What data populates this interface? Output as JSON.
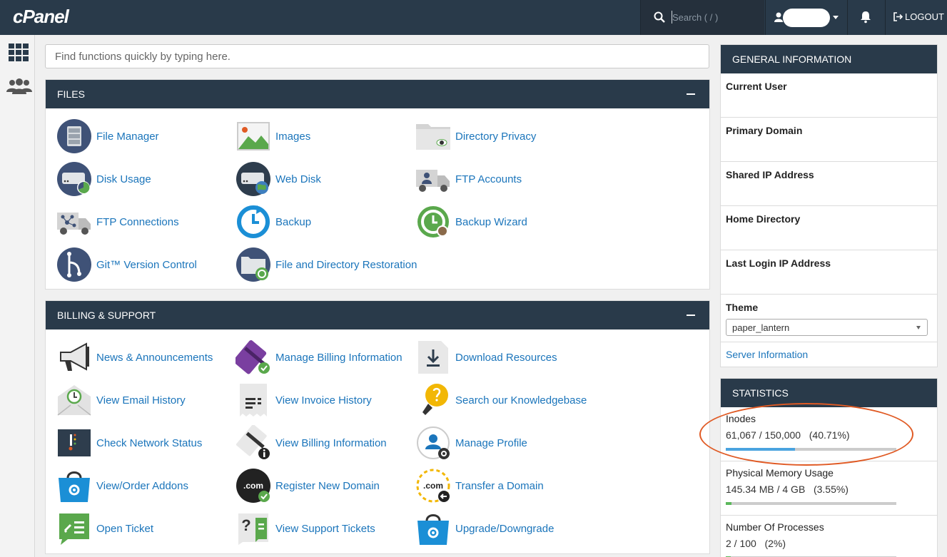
{
  "topbar": {
    "logo": "cPanel",
    "search_placeholder": "Search ( / )",
    "logout_label": "LOGOUT"
  },
  "main": {
    "search_placeholder": "Find functions quickly by typing here."
  },
  "files": {
    "title": "FILES",
    "items": [
      {
        "label": "File Manager",
        "icon": "file-manager-icon"
      },
      {
        "label": "Images",
        "icon": "images-icon"
      },
      {
        "label": "Directory Privacy",
        "icon": "directory-privacy-icon"
      },
      {
        "label": "Disk Usage",
        "icon": "disk-usage-icon"
      },
      {
        "label": "Web Disk",
        "icon": "web-disk-icon"
      },
      {
        "label": "FTP Accounts",
        "icon": "ftp-accounts-icon"
      },
      {
        "label": "FTP Connections",
        "icon": "ftp-connections-icon"
      },
      {
        "label": "Backup",
        "icon": "backup-icon"
      },
      {
        "label": "Backup Wizard",
        "icon": "backup-wizard-icon"
      },
      {
        "label": "Git™ Version Control",
        "icon": "git-icon"
      },
      {
        "label": "File and Directory Restoration",
        "icon": "restoration-icon"
      }
    ]
  },
  "billing": {
    "title": "BILLING & SUPPORT",
    "items": [
      {
        "label": "News & Announcements",
        "icon": "megaphone-icon"
      },
      {
        "label": "Manage Billing Information",
        "icon": "credit-card-check-icon"
      },
      {
        "label": "Download Resources",
        "icon": "download-icon"
      },
      {
        "label": "View Email History",
        "icon": "email-history-icon"
      },
      {
        "label": "View Invoice History",
        "icon": "invoice-icon"
      },
      {
        "label": "Search our Knowledgebase",
        "icon": "lightbulb-icon"
      },
      {
        "label": "Check Network Status",
        "icon": "network-status-icon"
      },
      {
        "label": "View Billing Information",
        "icon": "billing-info-icon"
      },
      {
        "label": "Manage Profile",
        "icon": "profile-icon"
      },
      {
        "label": "View/Order Addons",
        "icon": "addons-bag-icon"
      },
      {
        "label": "Register New Domain",
        "icon": "register-domain-icon"
      },
      {
        "label": "Transfer a Domain",
        "icon": "transfer-domain-icon"
      },
      {
        "label": "Open Ticket",
        "icon": "ticket-icon"
      },
      {
        "label": "View Support Tickets",
        "icon": "support-tickets-icon"
      },
      {
        "label": "Upgrade/Downgrade",
        "icon": "upgrade-bag-icon"
      }
    ]
  },
  "general_info": {
    "title": "GENERAL INFORMATION",
    "current_user": "Current User",
    "primary_domain": "Primary Domain",
    "shared_ip": "Shared IP Address",
    "home_directory": "Home Directory",
    "last_login_ip": "Last Login IP Address",
    "theme_label": "Theme",
    "theme_value": "paper_lantern",
    "server_info": "Server Information"
  },
  "statistics": {
    "title": "STATISTICS",
    "rows": [
      {
        "label": "Inodes",
        "value": "61,067 / 150,000   (40.71%)",
        "percent": 40.71,
        "color": "#4aa3df"
      },
      {
        "label": "Physical Memory Usage",
        "value": "145.34 MB / 4 GB   (3.55%)",
        "percent": 3.55,
        "color": "#5cb85c"
      },
      {
        "label": "Number Of Processes",
        "value": "2 / 100   (2%)",
        "percent": 2,
        "color": "#5cb85c"
      }
    ]
  },
  "colors": {
    "header_bg": "#293a4a",
    "link": "#1b75bb",
    "annotation": "#e05a24"
  }
}
